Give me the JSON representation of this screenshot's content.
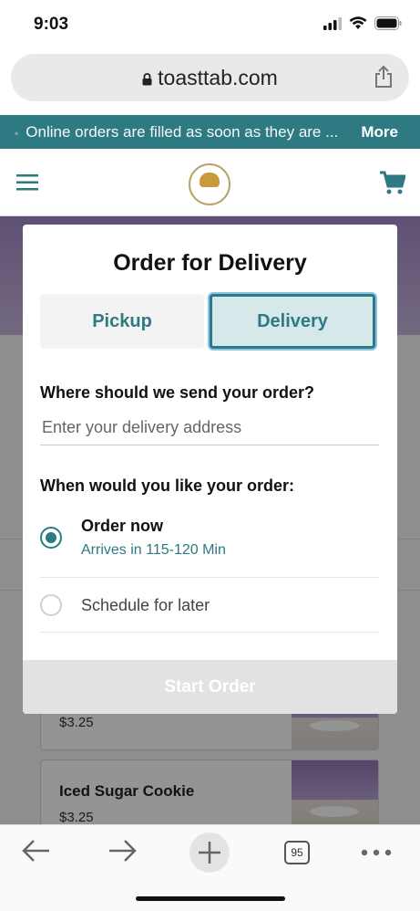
{
  "status_bar": {
    "time": "9:03"
  },
  "url_bar": {
    "domain": "toasttab.com"
  },
  "banner": {
    "text": "Online orders are filled as soon as they are ...",
    "more": "More"
  },
  "menu_items": [
    {
      "title": "",
      "price": "$3.25"
    },
    {
      "title": "Iced Sugar Cookie",
      "price": "$3.25"
    }
  ],
  "modal": {
    "title": "Order for Delivery",
    "tabs": {
      "pickup": "Pickup",
      "delivery": "Delivery",
      "selected": "Delivery"
    },
    "address_question": "Where should we send your order?",
    "address_placeholder": "Enter your delivery address",
    "address_value": "",
    "time_question": "When would you like your order:",
    "options": [
      {
        "title": "Order now",
        "subtitle": "Arrives in 115-120 Min",
        "selected": true
      },
      {
        "title": "Schedule for later",
        "subtitle": "",
        "selected": false
      }
    ],
    "start_button": "Start Order"
  },
  "bottom_bar": {
    "tab_count": "95"
  },
  "colors": {
    "accent": "#2e7a82",
    "disabled": "#e2e2e2"
  }
}
